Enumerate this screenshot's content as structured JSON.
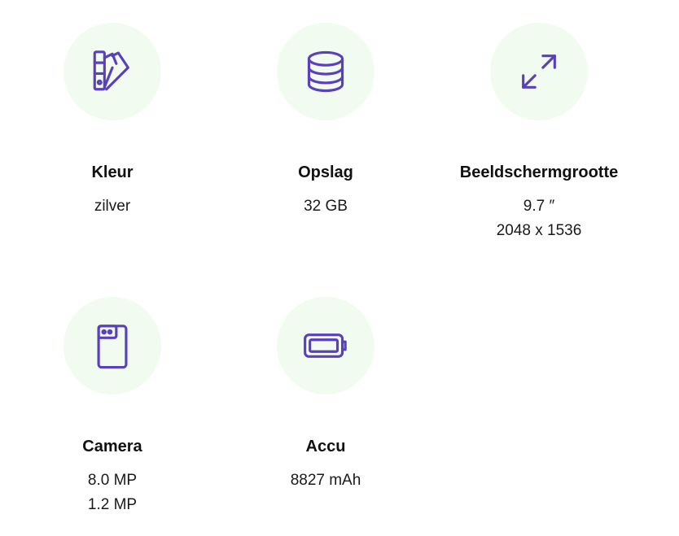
{
  "accent_color": "#5a3fc0",
  "circle_color": "#f2fbef",
  "specs": [
    {
      "icon": "color-swatch-icon",
      "title": "Kleur",
      "values": [
        "zilver"
      ]
    },
    {
      "icon": "storage-database-icon",
      "title": "Opslag",
      "values": [
        "32 GB"
      ]
    },
    {
      "icon": "expand-arrows-icon",
      "title": "Beeldschermgrootte",
      "values": [
        "9.7 ″",
        "2048 x 1536"
      ]
    },
    {
      "icon": "camera-phone-icon",
      "title": "Camera",
      "values": [
        "8.0 MP",
        "1.2 MP"
      ]
    },
    {
      "icon": "battery-icon",
      "title": "Accu",
      "values": [
        "8827 mAh"
      ]
    }
  ]
}
